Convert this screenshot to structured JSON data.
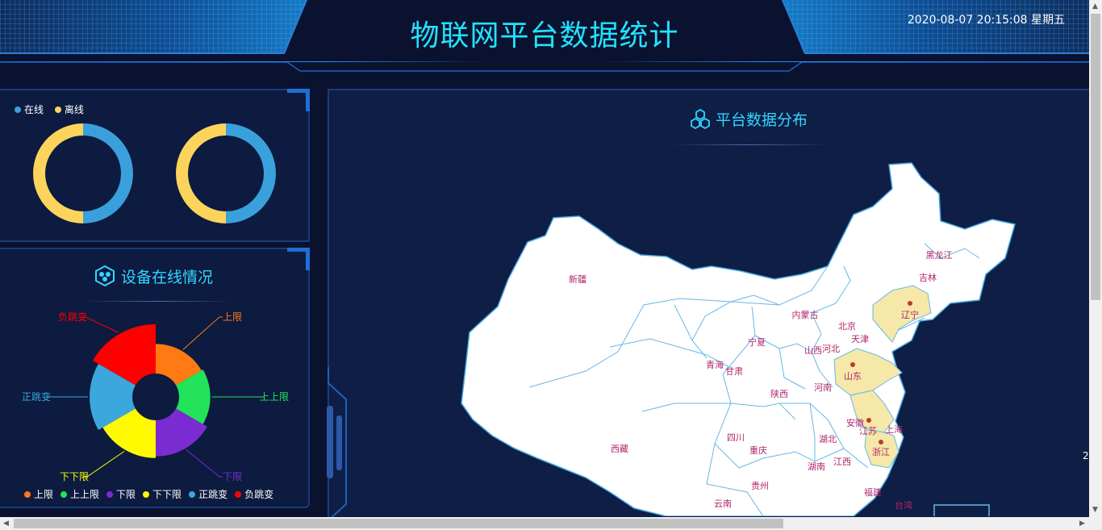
{
  "header": {
    "title": "物联网平台数据统计",
    "datetime": "2020-08-07 20:15:08 星期五"
  },
  "online_panel": {
    "legend": [
      {
        "label": "在线",
        "color": "#3aa0dc"
      },
      {
        "label": "离线",
        "color": "#fcd45c"
      }
    ],
    "donuts": [
      {
        "online": 50,
        "offline": 50
      },
      {
        "online": 50,
        "offline": 50
      }
    ]
  },
  "device_panel": {
    "title": "设备在线情况",
    "icon": "hexagon-cluster-icon"
  },
  "map_panel": {
    "title": "平台数据分布",
    "icon": "hexagon-cluster-icon",
    "highlighted_provinces": [
      "辽宁",
      "山东",
      "江苏",
      "浙江",
      "上海"
    ],
    "province_labels": [
      "新疆",
      "西藏",
      "青海",
      "甘肃",
      "宁夏",
      "内蒙古",
      "黑龙江",
      "吉林",
      "辽宁",
      "北京",
      "天津",
      "河北",
      "山西",
      "陕西",
      "河南",
      "山东",
      "江苏",
      "安徽",
      "上海",
      "浙江",
      "湖北",
      "四川",
      "重庆",
      "湖南",
      "江西",
      "贵州",
      "云南",
      "福建",
      "台湾"
    ],
    "page_edge_number": "2"
  },
  "chart_data": {
    "type": "pie",
    "variant": "rose",
    "categories": [
      "上限",
      "上上限",
      "下限",
      "下下限",
      "正跳变",
      "负跳变"
    ],
    "values": [
      14,
      15,
      18,
      19,
      22,
      26
    ],
    "colors": [
      "#ff7a12",
      "#22e35a",
      "#7a2bd2",
      "#fffa00",
      "#3ba7dc",
      "#ff0000"
    ],
    "title": "",
    "legend_position": "bottom"
  },
  "scrollbars": {
    "up": "▲",
    "down": "▼",
    "left": "◀",
    "right": "▶"
  }
}
